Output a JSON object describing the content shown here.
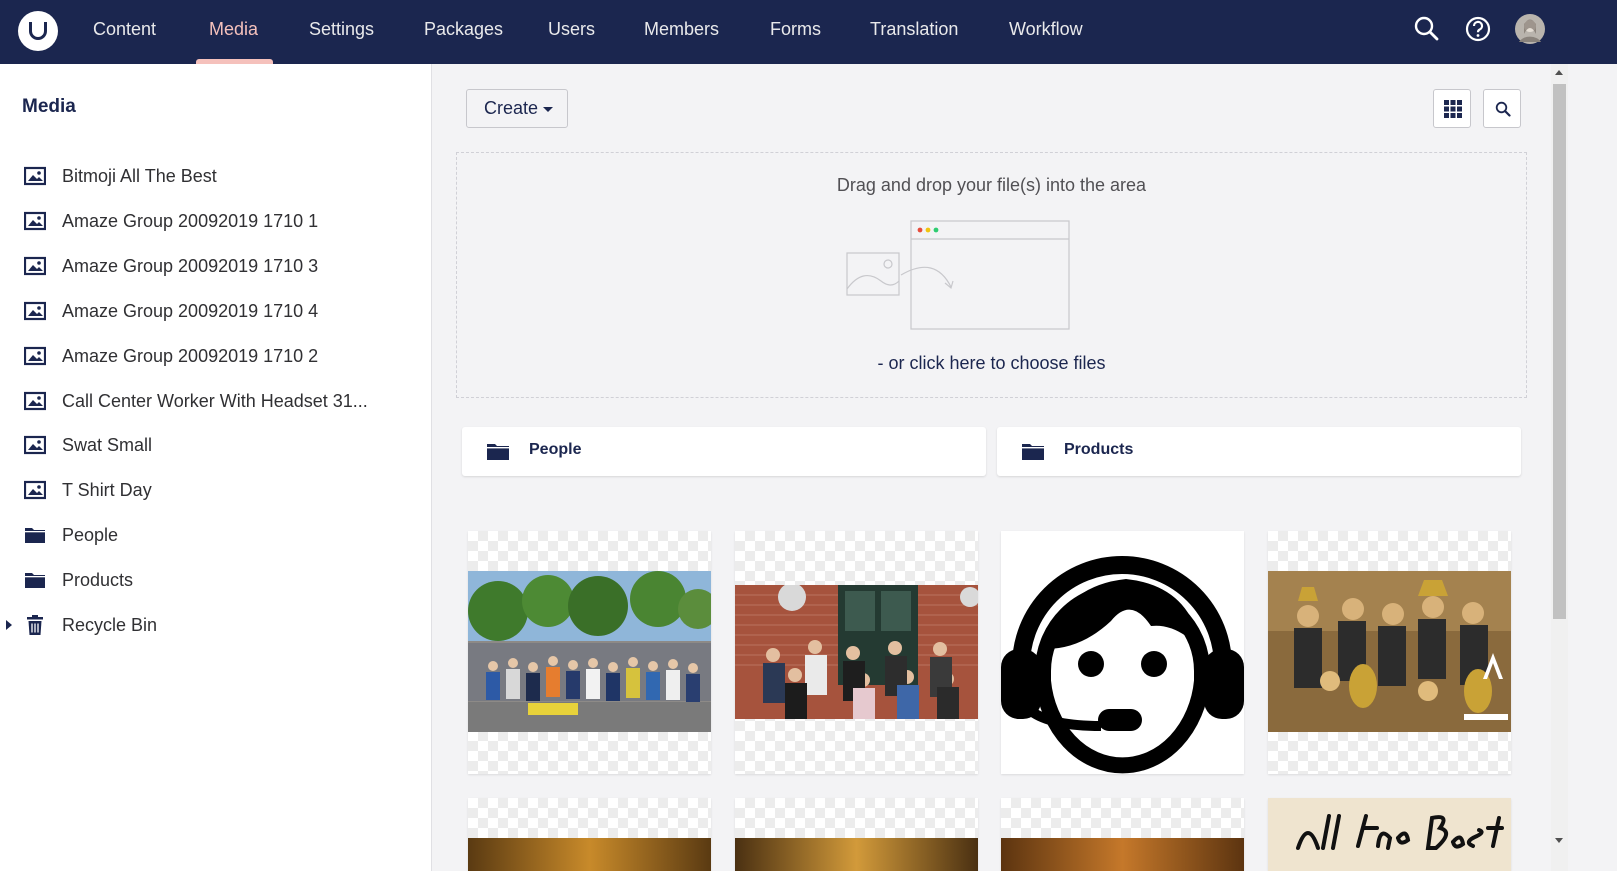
{
  "topnav": {
    "items": [
      "Content",
      "Media",
      "Settings",
      "Packages",
      "Users",
      "Members",
      "Forms",
      "Translation",
      "Workflow"
    ],
    "active": "Media",
    "icons": [
      "search-icon",
      "help-icon",
      "user-avatar"
    ]
  },
  "sidebar": {
    "title": "Media",
    "items": [
      {
        "label": "Bitmoji All The Best",
        "icon": "image-icon"
      },
      {
        "label": "Amaze Group 20092019 1710 1",
        "icon": "image-icon"
      },
      {
        "label": "Amaze Group 20092019 1710 3",
        "icon": "image-icon"
      },
      {
        "label": "Amaze Group 20092019 1710 4",
        "icon": "image-icon"
      },
      {
        "label": "Amaze Group 20092019 1710 2",
        "icon": "image-icon"
      },
      {
        "label": "Call Center Worker With Headset 31...",
        "icon": "image-icon"
      },
      {
        "label": "Swat Small",
        "icon": "image-icon"
      },
      {
        "label": "T Shirt Day",
        "icon": "image-icon"
      },
      {
        "label": "People",
        "icon": "folder-icon"
      },
      {
        "label": "Products",
        "icon": "folder-icon"
      },
      {
        "label": "Recycle Bin",
        "icon": "trash-icon"
      }
    ]
  },
  "toolbar": {
    "create_label": "Create"
  },
  "dropzone": {
    "text": "Drag and drop your file(s) into the area",
    "link": "- or click here to choose files"
  },
  "folders": [
    {
      "label": "People"
    },
    {
      "label": "Products"
    }
  ],
  "colors": {
    "header": "#1b264f",
    "accent": "#f5c1bc",
    "background": "#f3f3f5"
  }
}
